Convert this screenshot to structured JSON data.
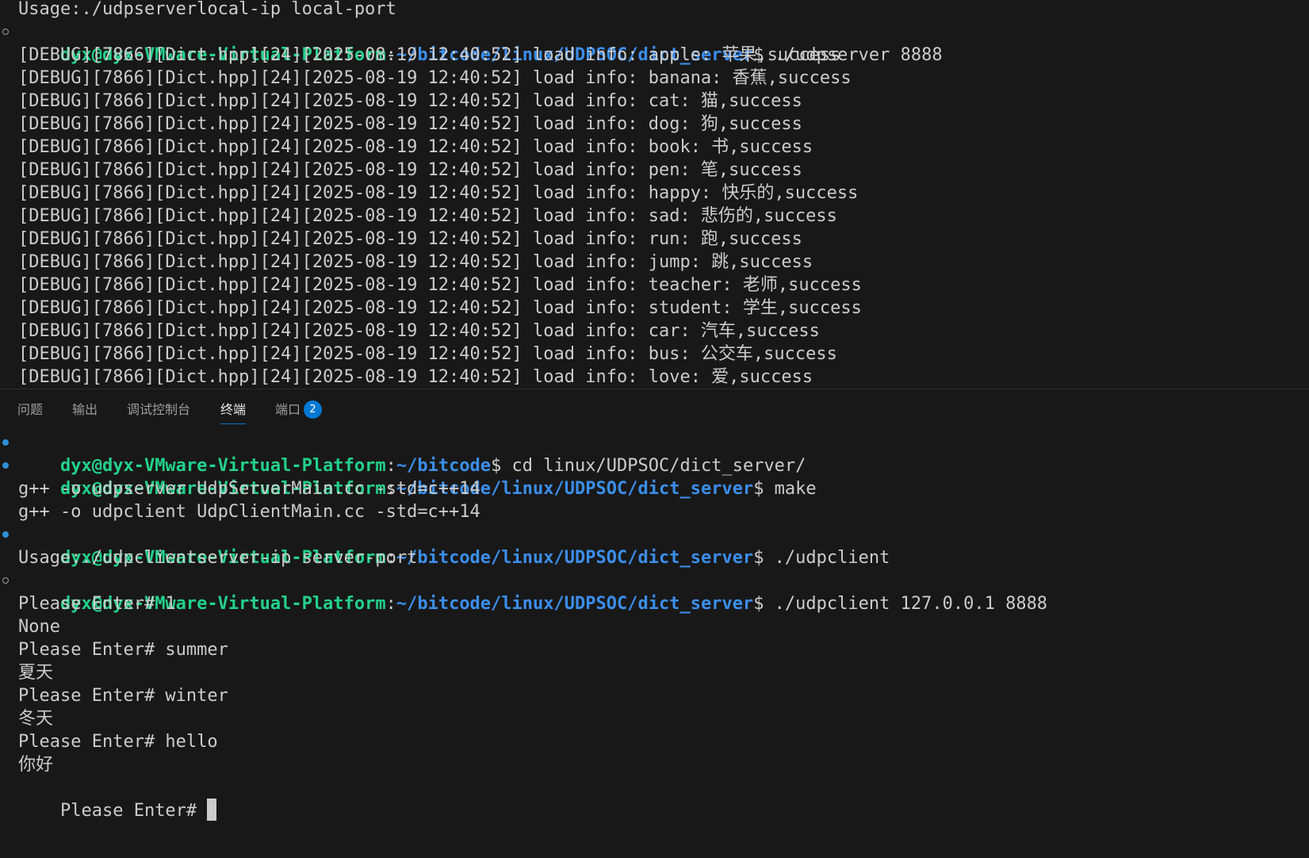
{
  "colors": {
    "background": "#181818",
    "text": "#cccccc",
    "user_host": "#23d18b",
    "path": "#3b8eea",
    "accent": "#0078d4"
  },
  "top_terminal": {
    "header_line": "Usage:./udpserverlocal-ip local-port",
    "prompt": {
      "user_host": "dyx@dyx-VMware-Virtual-Platform",
      "colon": ":",
      "path": "~/bitcode/linux/UDPSOC/dict_server",
      "dollar": "$",
      "command": " ./udpserver 8888"
    },
    "log_lines": [
      "[DEBUG][7866][Dict.hpp][24][2025-08-19 12:40:52] load info: apple: 苹果,success",
      "[DEBUG][7866][Dict.hpp][24][2025-08-19 12:40:52] load info: banana: 香蕉,success",
      "[DEBUG][7866][Dict.hpp][24][2025-08-19 12:40:52] load info: cat: 猫,success",
      "[DEBUG][7866][Dict.hpp][24][2025-08-19 12:40:52] load info: dog: 狗,success",
      "[DEBUG][7866][Dict.hpp][24][2025-08-19 12:40:52] load info: book: 书,success",
      "[DEBUG][7866][Dict.hpp][24][2025-08-19 12:40:52] load info: pen: 笔,success",
      "[DEBUG][7866][Dict.hpp][24][2025-08-19 12:40:52] load info: happy: 快乐的,success",
      "[DEBUG][7866][Dict.hpp][24][2025-08-19 12:40:52] load info: sad: 悲伤的,success",
      "[DEBUG][7866][Dict.hpp][24][2025-08-19 12:40:52] load info: run: 跑,success",
      "[DEBUG][7866][Dict.hpp][24][2025-08-19 12:40:52] load info: jump: 跳,success",
      "[DEBUG][7866][Dict.hpp][24][2025-08-19 12:40:52] load info: teacher: 老师,success",
      "[DEBUG][7866][Dict.hpp][24][2025-08-19 12:40:52] load info: student: 学生,success",
      "[DEBUG][7866][Dict.hpp][24][2025-08-19 12:40:52] load info: car: 汽车,success",
      "[DEBUG][7866][Dict.hpp][24][2025-08-19 12:40:52] load info: bus: 公交车,success",
      "[DEBUG][7866][Dict.hpp][24][2025-08-19 12:40:52] load info: love: 爱,success"
    ]
  },
  "panel_tabs": [
    {
      "label": "问题",
      "active": false
    },
    {
      "label": "输出",
      "active": false
    },
    {
      "label": "调试控制台",
      "active": false
    },
    {
      "label": "终端",
      "active": true
    },
    {
      "label": "端口",
      "active": false,
      "badge": "2"
    }
  ],
  "bottom_terminal": {
    "prompt1": {
      "user_host": "dyx@dyx-VMware-Virtual-Platform",
      "colon": ":",
      "path": "~/bitcode",
      "dollar": "$",
      "command": " cd linux/UDPSOC/dict_server/"
    },
    "prompt2": {
      "user_host": "dyx@dyx-VMware-Virtual-Platform",
      "colon": ":",
      "path": "~/bitcode/linux/UDPSOC/dict_server",
      "dollar": "$",
      "command": " make"
    },
    "make_output": [
      "g++ -o udpserver UdpServerMain.cc -std=c++14",
      "g++ -o udpclient UdpClientMain.cc -std=c++14"
    ],
    "prompt3": {
      "user_host": "dyx@dyx-VMware-Virtual-Platform",
      "colon": ":",
      "path": "~/bitcode/linux/UDPSOC/dict_server",
      "dollar": "$",
      "command": " ./udpclient"
    },
    "usage_line": "Usage:./udpclientserver-ip server-port",
    "prompt4": {
      "user_host": "dyx@dyx-VMware-Virtual-Platform",
      "colon": ":",
      "path": "~/bitcode/linux/UDPSOC/dict_server",
      "dollar": "$",
      "command": " ./udpclient 127.0.0.1 8888"
    },
    "session_lines": [
      "Please Enter# 1",
      "None",
      "Please Enter# summer",
      "夏天",
      "Please Enter# winter",
      "冬天",
      "Please Enter# hello",
      "你好"
    ],
    "final_prompt": "Please Enter# "
  }
}
